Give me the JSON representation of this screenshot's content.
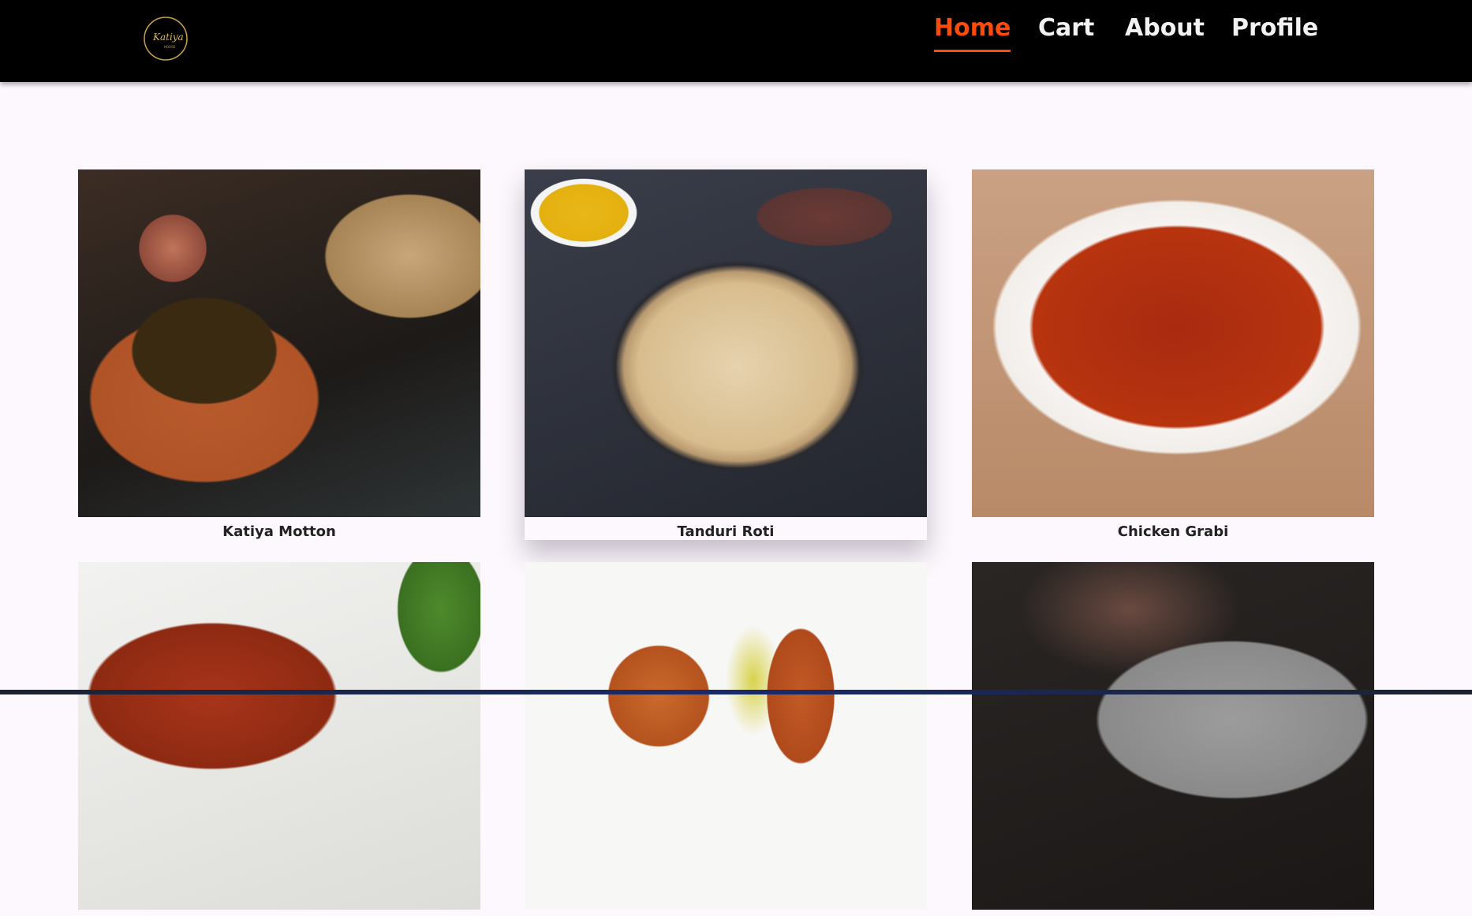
{
  "nav": {
    "logo_text": "Katiya House",
    "items": [
      {
        "label": "Home",
        "active": true
      },
      {
        "label": "Cart",
        "active": false
      },
      {
        "label": "About",
        "active": false
      },
      {
        "label": "Profile",
        "active": false
      }
    ],
    "accent_color": "#ff4a0a"
  },
  "products": [
    {
      "name": "Katiya Motton"
    },
    {
      "name": "Tanduri Roti"
    },
    {
      "name": "Chicken Grabi"
    },
    {
      "name": ""
    },
    {
      "name": ""
    },
    {
      "name": ""
    }
  ]
}
